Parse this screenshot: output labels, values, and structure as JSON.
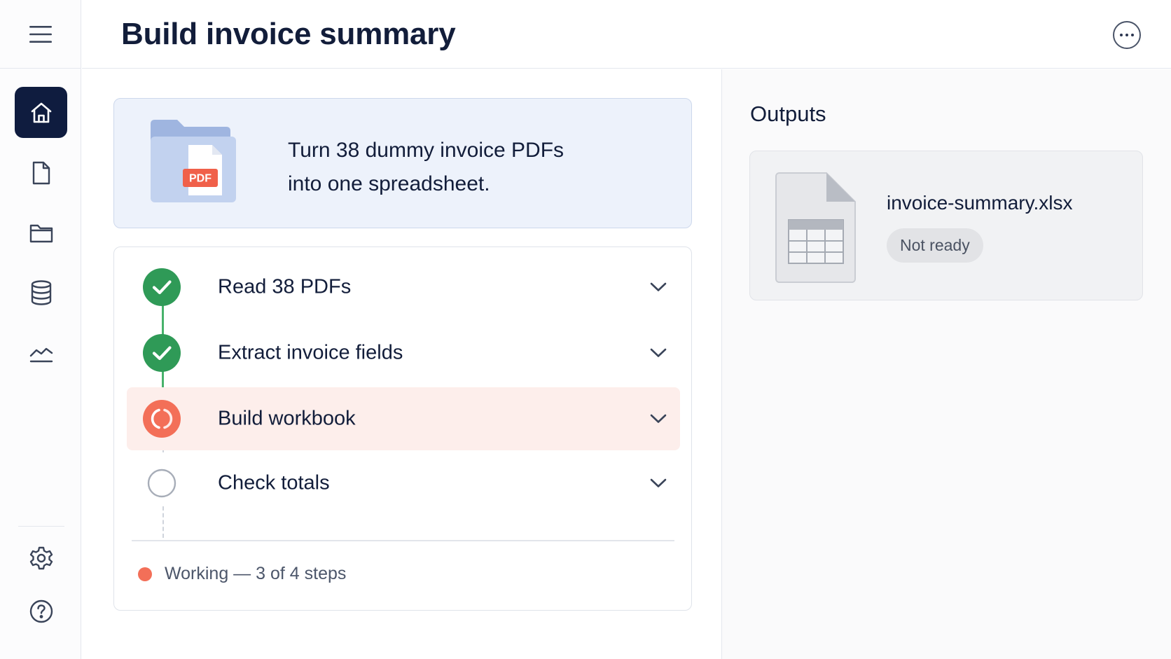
{
  "header": {
    "title": "Build invoice summary"
  },
  "sidebar": {
    "items": [
      {
        "icon": "home-icon",
        "active": true
      },
      {
        "icon": "document-icon",
        "active": false
      },
      {
        "icon": "folder-icon",
        "active": false
      },
      {
        "icon": "database-icon",
        "active": false
      },
      {
        "icon": "analytics-icon",
        "active": false
      }
    ],
    "bottom_items": [
      {
        "icon": "settings-icon"
      },
      {
        "icon": "help-icon"
      }
    ]
  },
  "task": {
    "line1": "Turn 38 dummy invoice PDFs",
    "line2": "into one spreadsheet.",
    "file_badge": "PDF"
  },
  "steps": [
    {
      "label": "Read 38 PDFs",
      "state": "done"
    },
    {
      "label": "Extract invoice fields",
      "state": "done"
    },
    {
      "label": "Build workbook",
      "state": "in-progress"
    },
    {
      "label": "Check totals",
      "state": "pending"
    }
  ],
  "status": {
    "text": "Working — 3 of 4 steps",
    "color": "#f36f58"
  },
  "outputs": {
    "title": "Outputs",
    "files": [
      {
        "name": "invoice-summary.xlsx",
        "status": "Not ready"
      }
    ]
  },
  "colors": {
    "primary_dark": "#0f1c3f",
    "success": "#2f9a57",
    "active_step": "#f36f58",
    "active_step_bg": "#fdeeeb"
  }
}
